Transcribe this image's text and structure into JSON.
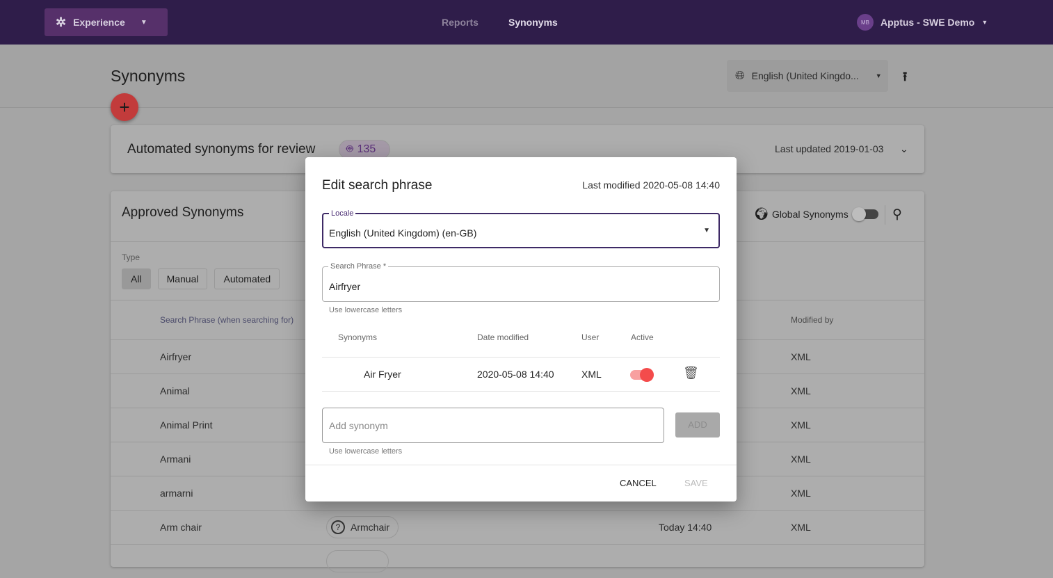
{
  "topbar": {
    "app_button": "Experience",
    "nav": [
      "Reports",
      "Synonyms"
    ],
    "avatar": "MB",
    "user": "Apptus - SWE Demo"
  },
  "page": {
    "title": "Synonyms",
    "locale_select": "English (United Kingdo...",
    "add_icon": "plus-icon",
    "upload_icon": "upload-icon"
  },
  "automated": {
    "title": "Automated synonyms for review",
    "count": "135",
    "last_updated": "Last updated 2019-01-03"
  },
  "approved": {
    "title": "Approved Synonyms",
    "global_label": "Global Synonyms",
    "global_enabled": false,
    "type_label": "Type",
    "filters": [
      "All",
      "Manual",
      "Automated"
    ],
    "active_filter": "All",
    "columns": {
      "phrase": "Search Phrase (when searching for)",
      "modified_by": "Modified by"
    },
    "rows": [
      {
        "phrase": "Airfryer",
        "modified_by": "XML"
      },
      {
        "phrase": "Animal",
        "modified_by": "XML"
      },
      {
        "phrase": "Animal Print",
        "modified_by": "XML"
      },
      {
        "phrase": "Armani",
        "modified_by": "XML"
      },
      {
        "phrase": "armarni",
        "modified_by": "XML"
      },
      {
        "phrase": "Arm chair",
        "synonym": "Armchair",
        "date": "Today 14:40",
        "modified_by": "XML"
      }
    ]
  },
  "dialog": {
    "title": "Edit search phrase",
    "last_modified": "Last modified 2020-05-08 14:40",
    "locale_label": "Locale",
    "locale_value": "English (United Kingdom) (en-GB)",
    "phrase_label": "Search Phrase *",
    "phrase_value": "Airfryer",
    "helper": "Use lowercase letters",
    "columns": [
      "Synonyms",
      "Date modified",
      "User",
      "Active"
    ],
    "synonyms": [
      {
        "synonym": "Air Fryer",
        "date": "2020-05-08 14:40",
        "user": "XML",
        "active": true
      }
    ],
    "add_placeholder": "Add synonym",
    "add_button": "ADD",
    "cancel": "CANCEL",
    "save": "SAVE"
  },
  "colors": {
    "topbar": "#2f1d4a",
    "accent": "#4a2d73",
    "fab": "#c23b3b",
    "toggle_on": "#f44b4b"
  }
}
